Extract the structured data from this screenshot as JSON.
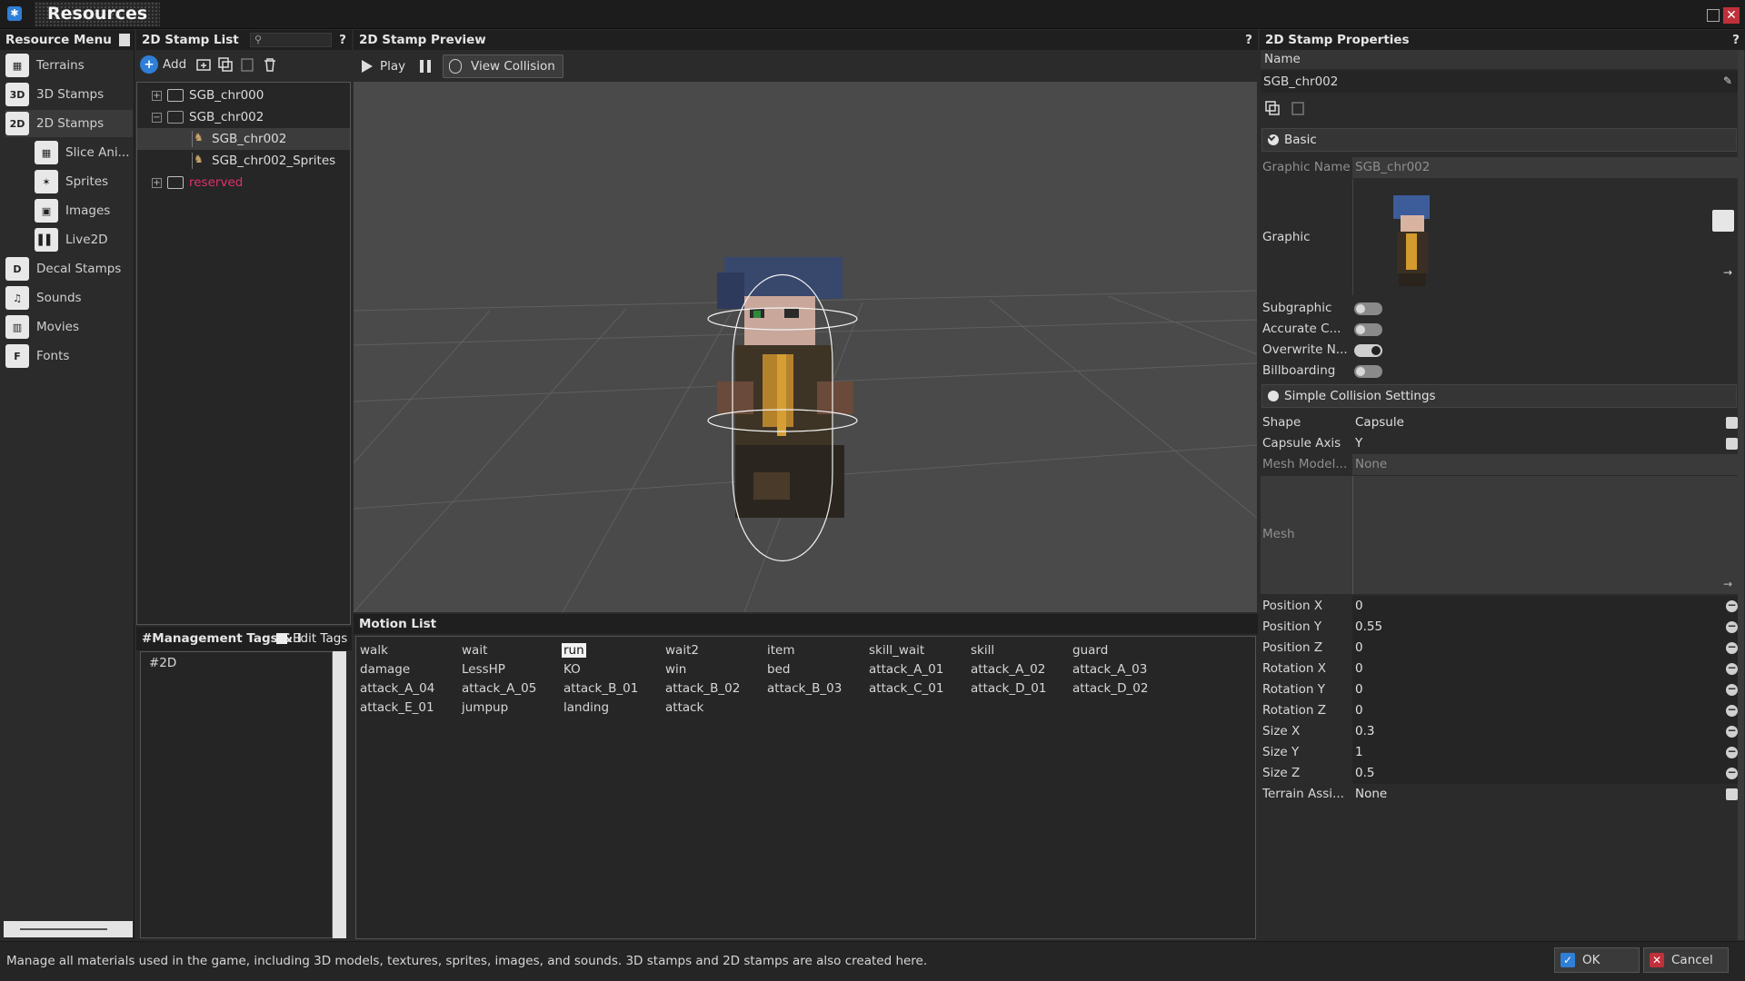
{
  "window": {
    "title": "Resources",
    "close_glyph": "✕"
  },
  "resource_menu": {
    "title": "Resource Menu",
    "items": [
      {
        "label": "Terrains",
        "icon": "terrain-icon"
      },
      {
        "label": "3D Stamps",
        "icon": "3d-stamps-icon"
      },
      {
        "label": "2D Stamps",
        "icon": "2d-stamps-icon",
        "selected": true
      },
      {
        "label": "Slice Ani...",
        "icon": "slice-animation-icon"
      },
      {
        "label": "Sprites",
        "icon": "sprites-icon"
      },
      {
        "label": "Images",
        "icon": "images-icon"
      },
      {
        "label": "Live2D",
        "icon": "live2d-icon"
      },
      {
        "label": "Decal Stamps",
        "icon": "decal-stamps-icon"
      },
      {
        "label": "Sounds",
        "icon": "sounds-icon"
      },
      {
        "label": "Movies",
        "icon": "movies-icon"
      },
      {
        "label": "Fonts",
        "icon": "fonts-icon"
      }
    ]
  },
  "stamp_list": {
    "title": "2D Stamp List",
    "help": "?",
    "add_label": "Add",
    "tree": [
      {
        "label": "SGB_chr000",
        "type": "folder",
        "expanded": false
      },
      {
        "label": "SGB_chr002",
        "type": "folder",
        "expanded": true
      },
      {
        "label": "SGB_chr002",
        "type": "stamp",
        "selected": true
      },
      {
        "label": "SGB_chr002_Sprites",
        "type": "stamp"
      },
      {
        "label": "reserved",
        "type": "folder",
        "expanded": false,
        "color": "#e0306a"
      }
    ]
  },
  "tags": {
    "title": "#Management Tags & I",
    "edit_label": "Edit Tags",
    "items": [
      "#2D"
    ]
  },
  "preview": {
    "title": "2D Stamp Preview",
    "help": "?",
    "play_label": "Play",
    "view_collision_label": "View Collision"
  },
  "motion_list": {
    "title": "Motion List",
    "selected": "run",
    "rows": [
      [
        "walk",
        "wait",
        "run",
        "wait2",
        "item",
        "skill_wait",
        "skill",
        "guard"
      ],
      [
        "damage",
        "LessHP",
        "KO",
        "win",
        "bed",
        "attack_A_01",
        "attack_A_02",
        "attack_A_03"
      ],
      [
        "attack_A_04",
        "attack_A_05",
        "attack_B_01",
        "attack_B_02",
        "attack_B_03",
        "attack_C_01",
        "attack_D_01",
        "attack_D_02"
      ],
      [
        "attack_E_01",
        "jumpup",
        "landing",
        "attack"
      ]
    ]
  },
  "properties": {
    "title": "2D Stamp Properties",
    "help": "?",
    "name_label": "Name",
    "name_value": "SGB_chr002",
    "basic_section": "Basic",
    "graphic_name_label": "Graphic Name",
    "graphic_name_value": "SGB_chr002",
    "graphic_label": "Graphic",
    "toggles": [
      {
        "label": "Subgraphic",
        "on": false
      },
      {
        "label": "Accurate C...",
        "on": false
      },
      {
        "label": "Overwrite N...",
        "on": true
      },
      {
        "label": "Billboarding",
        "on": false
      }
    ],
    "collision_section": "Simple Collision Settings",
    "shape_label": "Shape",
    "shape_value": "Capsule",
    "capsule_axis_label": "Capsule Axis",
    "capsule_axis_value": "Y",
    "mesh_model_label": "Mesh Model...",
    "mesh_model_value": "None",
    "mesh_label": "Mesh",
    "numeric": [
      {
        "label": "Position X",
        "value": "0"
      },
      {
        "label": "Position Y",
        "value": "0.55"
      },
      {
        "label": "Position Z",
        "value": "0"
      },
      {
        "label": "Rotation X",
        "value": "0"
      },
      {
        "label": "Rotation Y",
        "value": "0"
      },
      {
        "label": "Rotation Z",
        "value": "0"
      },
      {
        "label": "Size X",
        "value": "0.3"
      },
      {
        "label": "Size Y",
        "value": "1"
      },
      {
        "label": "Size Z",
        "value": "0.5"
      }
    ],
    "terrain_label": "Terrain Assi...",
    "terrain_value": "None"
  },
  "footer": {
    "status": "Manage all materials used in the game, including 3D models, textures, sprites, images, and sounds. 3D stamps and 2D stamps are also created here.",
    "ok_label": "OK",
    "cancel_label": "Cancel"
  },
  "colors": {
    "accent": "#2f7fd6",
    "reserved": "#e0306a",
    "cancel": "#c0303a"
  }
}
